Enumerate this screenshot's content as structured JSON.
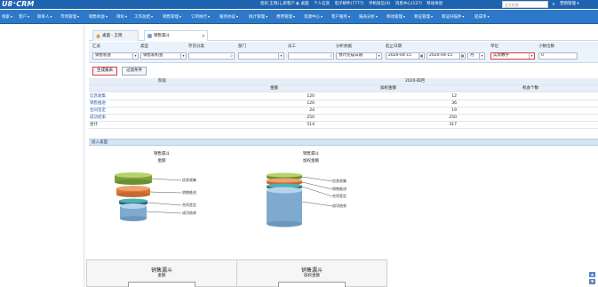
{
  "app": {
    "logo": "U8⁺CRM",
    "top_links": [
      "您好,王晓儿,新客户 ◐ 桌面",
      "个人信息",
      "电子邮件(7777)",
      "手机短信(0)",
      "消息中心(127)",
      "移动体验"
    ],
    "search_placeholder": "全文检索",
    "user_label": "营销管理 ▾"
  },
  "nav": {
    "items": [
      "线索",
      "客户",
      "联系人",
      "市场管理",
      "销售机会",
      "目标",
      "工作总结",
      "销售管理",
      "订单执行",
      "服务协议",
      "统计管理",
      "费用管理",
      "资源中心",
      "客户服务",
      "报表分析",
      "移动管理",
      "筹证管理",
      "筹证扫描件",
      "提成单"
    ]
  },
  "tabs": [
    {
      "label": "桌面 - 王晓",
      "icon": "home-icon"
    },
    {
      "label": "销售漏斗",
      "icon": "funnel-icon"
    }
  ],
  "filter": {
    "labels": [
      "汇总",
      "类型",
      "存货分类",
      "部门",
      "员工",
      "分析依据",
      "起止日期",
      "单位",
      "小数位数"
    ],
    "summary_value": "销售机会",
    "type_value": "销售新机会",
    "inventory_value": "",
    "department_value": "",
    "employee_value": "",
    "basis_value": "预计完成日期",
    "date_from": "2020-04-15",
    "date_to": "2020-04-15",
    "period_value": "月",
    "unit_value": "实际数字",
    "decimals_value": "0"
  },
  "buttons": {
    "generate": "生成报表",
    "filter_condition": "过滤条件"
  },
  "table": {
    "stage_header": "阶段",
    "period_header": "2020-四月",
    "columns": [
      "金额",
      "加权金额",
      "机会个数"
    ],
    "rows": [
      {
        "stage": "信息收集",
        "amount": "120",
        "weighted": "12",
        "count": ""
      },
      {
        "stage": "销售推进",
        "amount": "120",
        "weighted": "36",
        "count": ""
      },
      {
        "stage": "合同签定",
        "amount": "24",
        "weighted": "19",
        "count": ""
      },
      {
        "stage": "成功结束",
        "amount": "250",
        "weighted": "250",
        "count": ""
      },
      {
        "stage": "合计",
        "amount": "514",
        "weighted": "317",
        "count": ""
      }
    ]
  },
  "section": {
    "title": "加入桌面"
  },
  "charts": {
    "left_title": "销售漏斗",
    "left_sub": "金额",
    "right_title": "销售漏斗",
    "right_sub": "加权金额",
    "labels": [
      "信息收集",
      "销售推进",
      "合同签定",
      "成功结束"
    ],
    "colors": [
      "#8fb542",
      "#e8894a",
      "#2f8b91",
      "#8ab4d8"
    ]
  },
  "panels": [
    {
      "title": "销售漏斗",
      "sub": "金额"
    },
    {
      "title": "销售漏斗",
      "sub": "加权金额"
    }
  ]
}
